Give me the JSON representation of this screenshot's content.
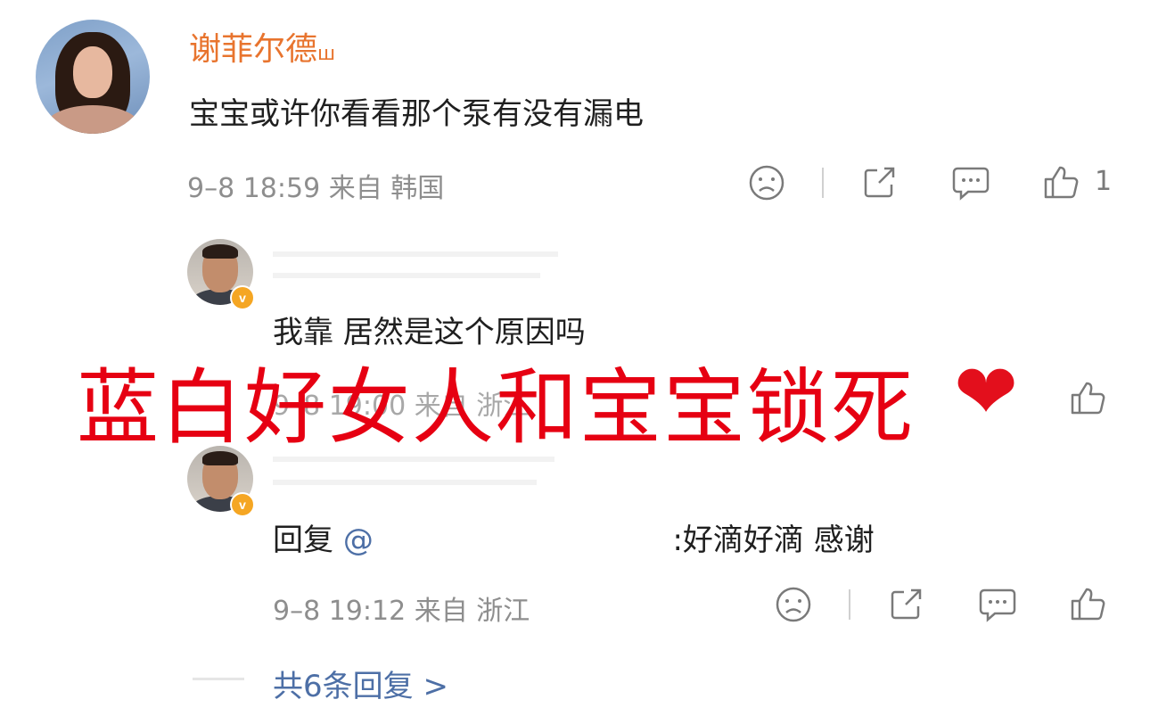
{
  "comments": [
    {
      "username": "谢菲尔德",
      "username_suffix": "ш",
      "text": "宝宝或许你看看那个泵有没有漏电",
      "meta": "9–8 18:59  来自 韩国",
      "like_count": "1"
    },
    {
      "text": "我靠 居然是这个原因吗",
      "meta": "9–8 19:00  来自 浙江",
      "verified_badge": "v"
    },
    {
      "reply_prefix": "回复",
      "mention": "@",
      "text": ":好滴好滴 感谢",
      "meta": "9–8 19:12  来自 浙江",
      "verified_badge": "v"
    }
  ],
  "replies_link": "共6条回复 >",
  "overlay_caption": "蓝白好女人和宝宝锁死",
  "overlay_heart": "❤",
  "colors": {
    "username": "#e8742e",
    "overlay": "#e60012",
    "link": "#4d6fa6",
    "meta": "#8e8e8e"
  },
  "icons": [
    "sad-face-icon",
    "share-icon",
    "comment-icon",
    "thumbs-up-icon",
    "verified-badge-icon"
  ]
}
